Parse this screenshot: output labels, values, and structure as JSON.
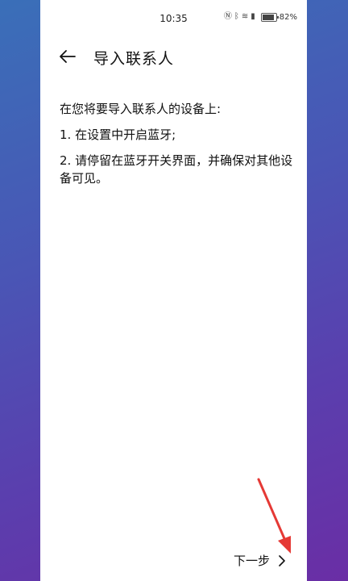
{
  "status_bar": {
    "time": "10:35",
    "battery": "82%",
    "icons": [
      "nfc-icon",
      "bluetooth-icon",
      "wifi-icon",
      "sim-icon",
      "battery-icon"
    ]
  },
  "header": {
    "back_icon": "back-arrow-icon",
    "title": "导入联系人"
  },
  "content": {
    "line1": "在您将要导入联系人的设备上:",
    "line2": "1. 在设置中开启蓝牙;",
    "line3": "2. 请停留在蓝牙开关界面，并确保对其他设备可见。"
  },
  "footer": {
    "next_label": "下一步",
    "next_icon": "chevron-right-icon"
  },
  "colors": {
    "annotation_arrow": "#e53935",
    "bg_top": "#3a6fb8",
    "bg_bottom": "#6a2ea5"
  }
}
